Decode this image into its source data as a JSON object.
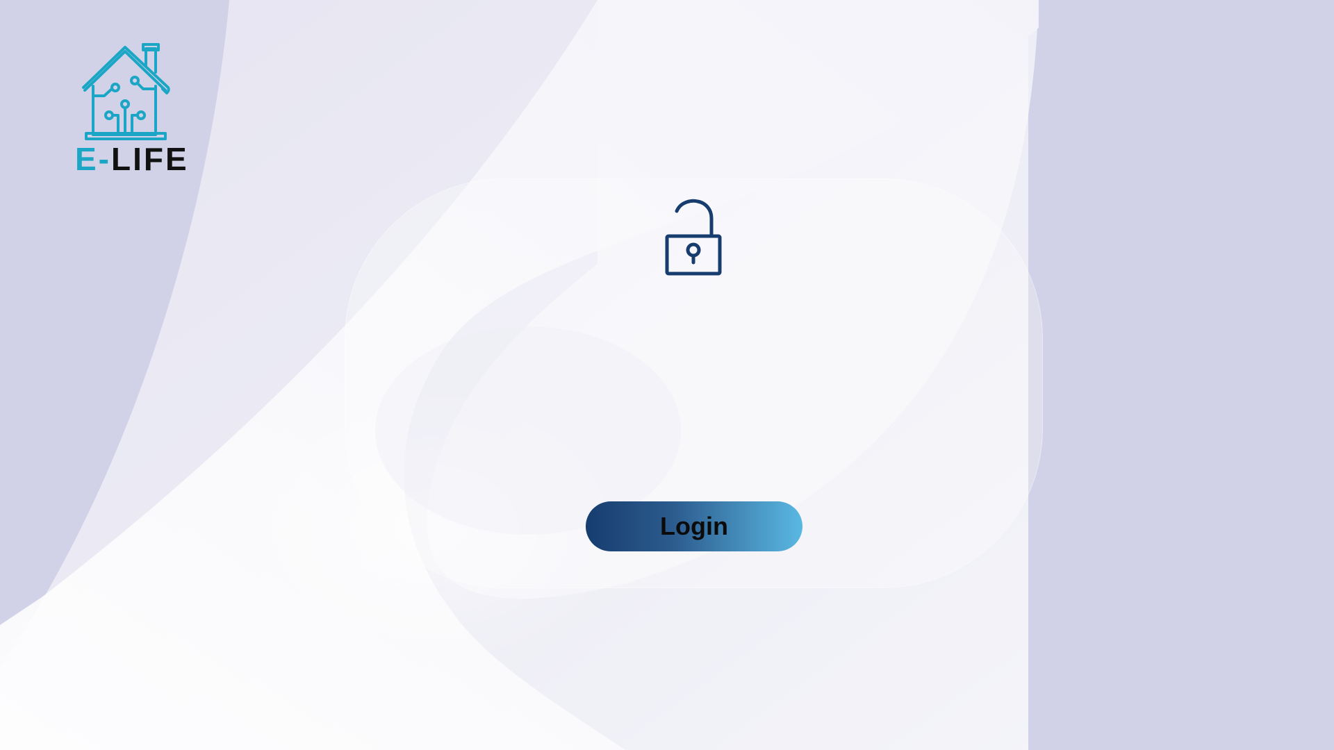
{
  "app": {
    "logo_text_prefix": "E-",
    "logo_text_suffix": "LIFE"
  },
  "main": {
    "login_label": "Login"
  },
  "icons": {
    "logo": "smart-home-icon",
    "lock": "unlocked-padlock-icon"
  },
  "colors": {
    "brand_teal": "#1aa6c4",
    "lock_navy": "#173d6f",
    "button_gradient_start": "#173d6f",
    "button_gradient_end": "#5ab8e2",
    "background": "#d1d2e7"
  }
}
